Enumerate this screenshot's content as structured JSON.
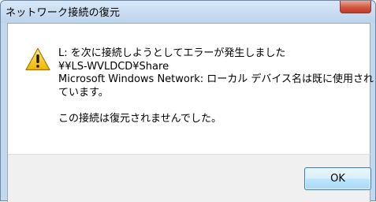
{
  "window": {
    "title": "ネットワーク接続の復元"
  },
  "icons": {
    "warning": "warning-triangle-icon",
    "close": "close-icon"
  },
  "message": {
    "lines": [
      "L: を次に接続しようとしてエラーが発生しました",
      "¥¥LS-WVLDCD¥Share",
      "Microsoft Windows Network: ローカル デバイス名は既に使用されています。"
    ],
    "line_a": "L: を次に接続しようとしてエラーが発生しました",
    "line_b": "¥¥LS-WVLDCD¥Share",
    "line_c1": "Microsoft Windows Network: ローカル デバイス名は既に使用され",
    "line_c2": "ています。",
    "line_d": "この接続は復元されませんでした。"
  },
  "buttons": {
    "ok_label": "OK"
  },
  "colors": {
    "frame": "#c2d8ef",
    "close_button": "#c0392b",
    "warning_yellow": "#f5c400",
    "ok_button": "#bee6fd"
  }
}
